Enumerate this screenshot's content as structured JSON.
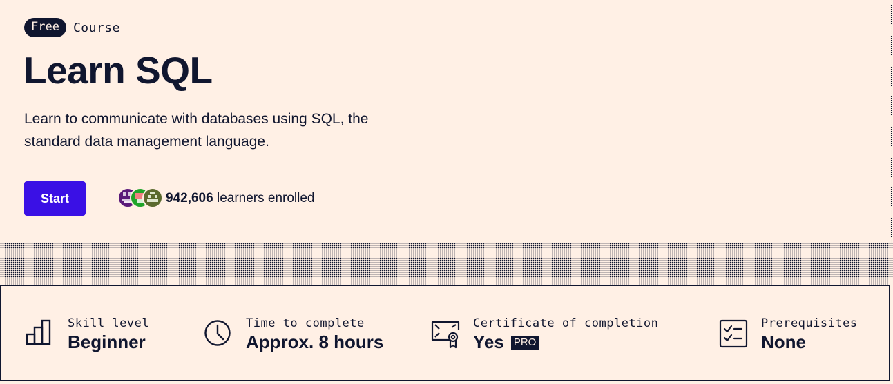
{
  "tag": {
    "free": "Free",
    "type": "Course"
  },
  "title": "Learn SQL",
  "description": "Learn to communicate with databases using SQL, the standard data management language.",
  "start_button": "Start",
  "learners": {
    "count": "942,606",
    "label": "learners enrolled"
  },
  "avatars": [
    {
      "icon": "learner-avatar-purple",
      "color": "#5a1a7a"
    },
    {
      "icon": "learner-avatar-green",
      "color": "#1fa42a"
    },
    {
      "icon": "learner-avatar-olive",
      "color": "#5b6a2e"
    }
  ],
  "stats": [
    {
      "icon": "bar-chart-icon",
      "label": "Skill level",
      "value": "Beginner"
    },
    {
      "icon": "clock-icon",
      "label": "Time to complete",
      "value": "Approx. 8 hours"
    },
    {
      "icon": "certificate-icon",
      "label": "Certificate of completion",
      "value": "Yes",
      "badge": "PRO"
    },
    {
      "icon": "checklist-icon",
      "label": "Prerequisites",
      "value": "None"
    }
  ],
  "colors": {
    "background": "#fff0e5",
    "text": "#10162f",
    "accent": "#3a10e5"
  }
}
